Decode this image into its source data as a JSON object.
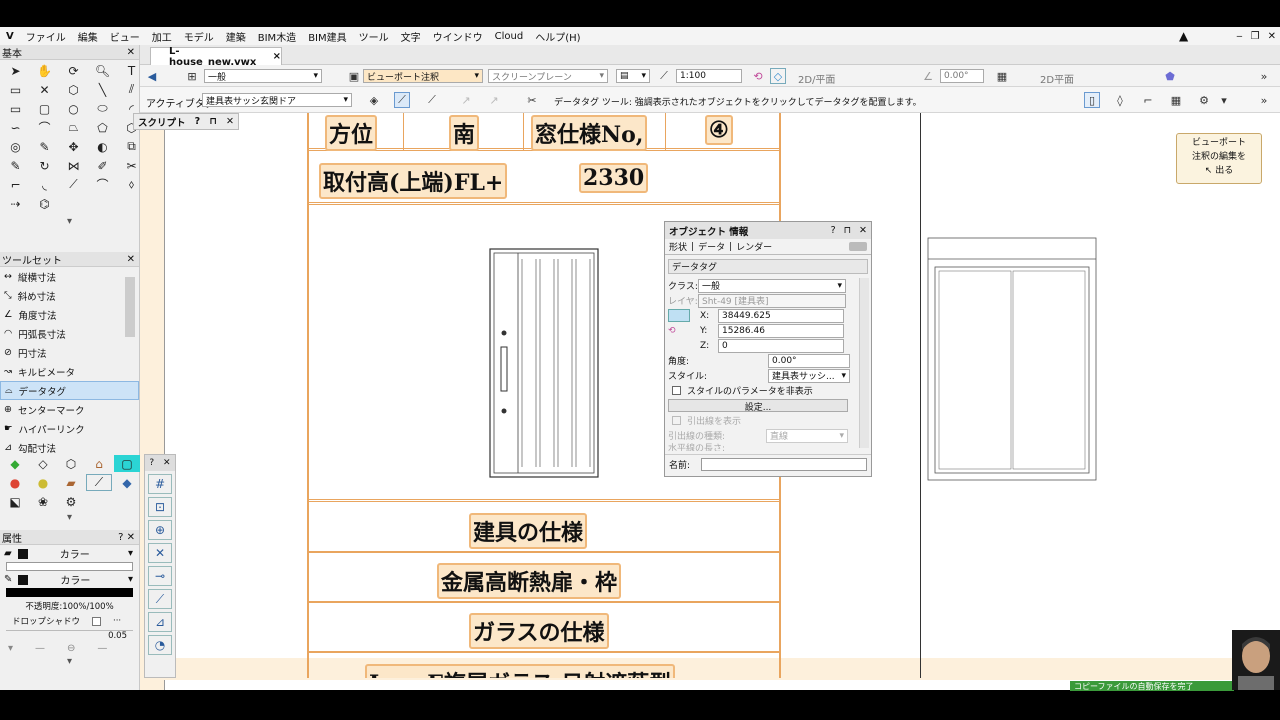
{
  "menu": [
    "ファイル",
    "編集",
    "ビュー",
    "加工",
    "モデル",
    "建築",
    "BIM木造",
    "BIM建具",
    "ツール",
    "文字",
    "ウインドウ",
    "Cloud",
    "ヘルプ(H)"
  ],
  "tab": {
    "title": "L-house_new.vwx",
    "close": "×"
  },
  "viewbar": {
    "class_value": "一般",
    "viewport_annotation": "ビューポート注釈",
    "screen_plane": "スクリーンプレーン",
    "scale": "1:100",
    "view_2d": "2D/平面",
    "angle": "0.00°",
    "plane": "2D平面"
  },
  "modebar": {
    "active_tag_label": "アクティブタグ:",
    "active_tag_value": "建具表サッシ玄関ドア",
    "hint": "データタグ ツール: 強調表示されたオブジェクトをクリックしてデータタグを配置します。"
  },
  "left": {
    "basic_title": "基本",
    "toolsets_title": "ツールセット",
    "tools": [
      "縦横寸法",
      "斜め寸法",
      "角度寸法",
      "円弧長寸法",
      "円寸法",
      "キルビメータ",
      "データタグ",
      "センターマーク",
      "ハイパーリンク",
      "勾配寸法"
    ],
    "selected_tool": "データタグ",
    "attr_title": "属性",
    "fill_label": "カラー",
    "pen_label": "カラー",
    "opacity": "不透明度:100%/100%",
    "shadow": "ドロップシャドウ",
    "lineweight": "0.05"
  },
  "script_palette": {
    "title": "スクリプト"
  },
  "drawing": {
    "row1": [
      "方位",
      "南",
      "窓仕様No,",
      "④"
    ],
    "row2": [
      "取付高(上端)FL+",
      "2330"
    ],
    "spec1": "建具の仕様",
    "spec2": "金属高断熱扉・枠",
    "spec3": "ガラスの仕様",
    "spec4": "Low-E複層ガラス 日射遮蔽型"
  },
  "oip": {
    "title": "オブジェクト 情報",
    "tabs": [
      "形状",
      "データ",
      "レンダー"
    ],
    "object_type": "データタグ",
    "class_label": "クラス:",
    "class_value": "一般",
    "layer_label": "レイヤ:",
    "layer_value": "Sht-49 [建具表]",
    "x_label": "X:",
    "x_value": "38449.625",
    "y_label": "Y:",
    "y_value": "15286.46",
    "z_label": "Z:",
    "z_value": "0",
    "angle_label": "角度:",
    "angle_value": "0.00°",
    "style_label": "スタイル:",
    "style_value": "建具表サッシ...",
    "hide_style_params": "スタイルのパラメータを非表示",
    "settings": "設定...",
    "show_leader": "引出線を表示",
    "leader_type_label": "引出線の種類:",
    "leader_type_value": "直線",
    "horizontal_length": "水平線の長さ:",
    "name_label": "名前:"
  },
  "callout": {
    "lines": [
      "ビューポート",
      "注釈の編集を",
      "出る"
    ]
  },
  "status": "コピーファイルの自動保存を完了"
}
